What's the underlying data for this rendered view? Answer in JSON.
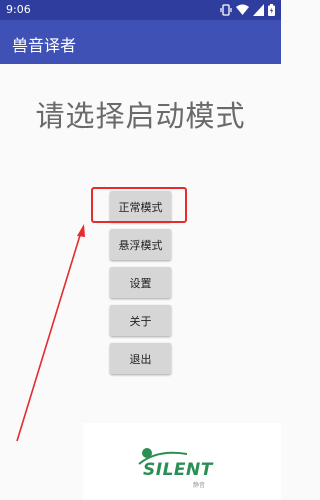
{
  "status_bar": {
    "time": "9:06",
    "icons": [
      "vibrate-icon",
      "wifi-icon",
      "signal-icon",
      "battery-icon"
    ]
  },
  "app_bar": {
    "title": "兽音译者"
  },
  "page": {
    "heading": "请选择启动模式"
  },
  "buttons": [
    {
      "label": "正常模式"
    },
    {
      "label": "悬浮模式"
    },
    {
      "label": "设置"
    },
    {
      "label": "关于"
    },
    {
      "label": "退出"
    }
  ],
  "annotation": {
    "color": "#e52b2b"
  },
  "watermark": {
    "text": "SILENT",
    "subtext": "静音"
  },
  "colors": {
    "app_bar": "#3f51b5",
    "status_bar": "#2f3e9e",
    "watermark": "#2b8f55"
  }
}
